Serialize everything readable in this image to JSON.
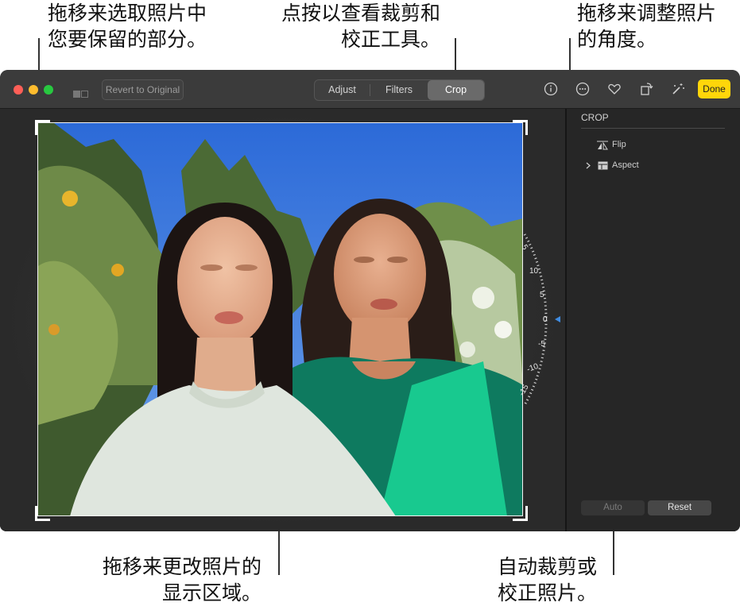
{
  "callouts": {
    "top_left": [
      "拖移来选取照片中",
      "您要保留的部分。"
    ],
    "top_center": [
      "点按以查看裁剪和",
      "校正工具。"
    ],
    "top_right": [
      "拖移来调整照片",
      "的角度。"
    ],
    "bottom_center": [
      "拖移来更改照片的",
      "显示区域。"
    ],
    "bottom_right": [
      "自动裁剪或",
      "校正照片。"
    ]
  },
  "toolbar": {
    "revert_label": "Revert to Original",
    "tabs": [
      "Adjust",
      "Filters",
      "Crop"
    ],
    "active_tab": "Crop",
    "done_label": "Done",
    "icons": [
      "info-icon",
      "more-icon",
      "heart-icon",
      "rotate-icon",
      "magic-wand-icon"
    ]
  },
  "panel": {
    "title": "CROP",
    "items": [
      {
        "label": "Flip",
        "icon": "flip-icon"
      },
      {
        "label": "Aspect",
        "icon": "aspect-icon",
        "expandable": true
      }
    ],
    "auto_label": "Auto",
    "reset_label": "Reset"
  },
  "dial": {
    "ticks": [
      "5",
      "10",
      "5",
      "0",
      "-5",
      "-10",
      "-15"
    ],
    "value": "0"
  },
  "colors": {
    "accent_done": "#ffd60a",
    "traffic_close": "#ff5f57",
    "traffic_min": "#febc2e",
    "traffic_max": "#28c840"
  }
}
